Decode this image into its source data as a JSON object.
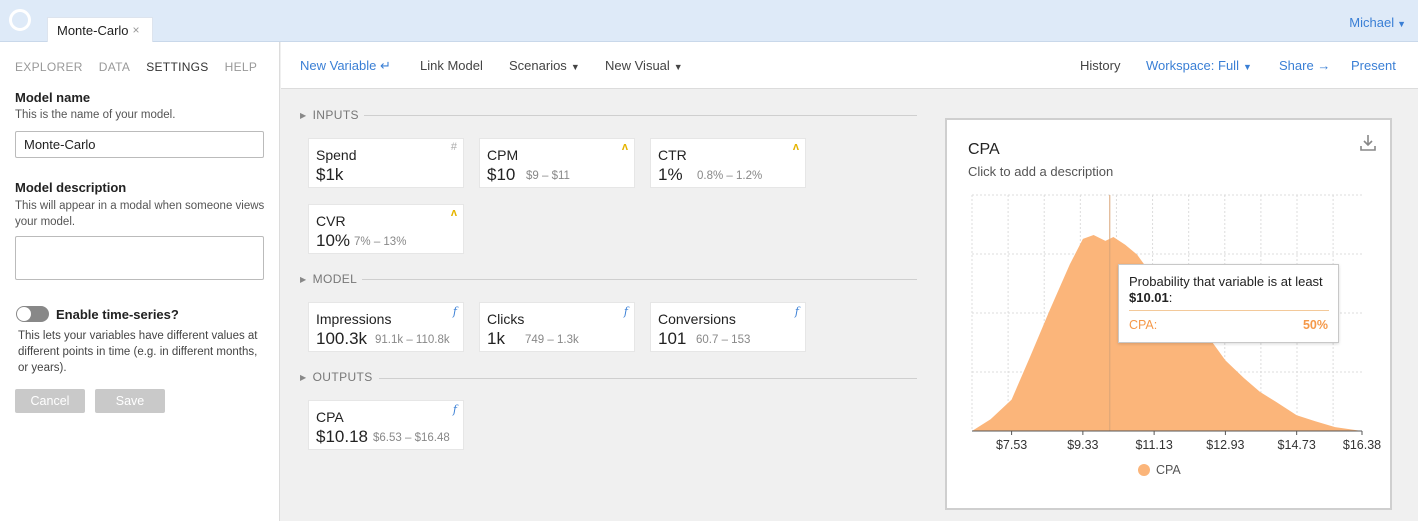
{
  "app": {
    "tab_label": "Monte-Carlo",
    "tab_close": "×",
    "user_name": "Michael"
  },
  "left_nav": [
    "EXPLORER",
    "DATA",
    "SETTINGS",
    "HELP"
  ],
  "left_nav_active": "SETTINGS",
  "settings": {
    "model_name_label": "Model name",
    "model_name_help": "This is the name of your model.",
    "model_name_value": "Monte-Carlo",
    "model_desc_label": "Model description",
    "model_desc_help": "This will appear in a modal when someone views your model.",
    "model_desc_value": "",
    "time_series_label": "Enable time-series?",
    "time_series_enabled": false,
    "time_series_help": "This lets your variables have different values at different points in time (e.g. in different months, or years).",
    "cancel_label": "Cancel",
    "save_label": "Save"
  },
  "toolbar": {
    "new_variable": "New Variable",
    "link_model": "Link Model",
    "scenarios": "Scenarios",
    "new_visual": "New Visual",
    "history": "History",
    "workspace": "Workspace: Full",
    "share": "Share",
    "present": "Present"
  },
  "sections": {
    "inputs": "INPUTS",
    "model": "MODEL",
    "outputs": "OUTPUTS"
  },
  "cards": {
    "spend": {
      "name": "Spend",
      "value": "$1k",
      "range": "",
      "icon": "hash-icon"
    },
    "cpm": {
      "name": "CPM",
      "value": "$10",
      "range": "$9 – $11",
      "icon": "distribution-icon"
    },
    "ctr": {
      "name": "CTR",
      "value": "1%",
      "range": "0.8% – 1.2%",
      "icon": "distribution-icon"
    },
    "cvr": {
      "name": "CVR",
      "value": "10%",
      "range": "7% – 13%",
      "icon": "distribution-icon"
    },
    "impressions": {
      "name": "Impressions",
      "value": "100.3k",
      "range": "91.1k – 110.8k",
      "icon": "function-icon"
    },
    "clicks": {
      "name": "Clicks",
      "value": "1k",
      "range": "749 – 1.3k",
      "icon": "function-icon"
    },
    "conversions": {
      "name": "Conversions",
      "value": "101",
      "range": "60.7 – 153",
      "icon": "function-icon"
    },
    "cpa": {
      "name": "CPA",
      "value": "$10.18",
      "range": "$6.53 – $16.48",
      "icon": "function-icon"
    }
  },
  "chart_panel": {
    "title": "CPA",
    "description": "Click to add a description",
    "tooltip_text_prefix": "Probability that variable is at least ",
    "tooltip_text_value": "$10.01",
    "tooltip_text_suffix": ":",
    "tooltip_series": "CPA:",
    "tooltip_value": "50%"
  },
  "chart_data": {
    "type": "area",
    "series": [
      {
        "name": "CPA",
        "color": "#fbb57a"
      }
    ],
    "x_ticks": [
      "$7.53",
      "$9.33",
      "$11.13",
      "$12.93",
      "$14.73",
      "$16.38"
    ],
    "x": [
      6.53,
      7.0,
      7.53,
      8.0,
      8.5,
      9.0,
      9.33,
      9.6,
      9.9,
      10.1,
      10.4,
      10.7,
      11.13,
      11.6,
      12.0,
      12.5,
      12.93,
      13.4,
      13.8,
      14.2,
      14.73,
      15.2,
      15.7,
      16.38
    ],
    "density": [
      0.0,
      0.06,
      0.16,
      0.38,
      0.62,
      0.85,
      0.98,
      1.0,
      0.97,
      0.99,
      0.95,
      0.9,
      0.78,
      0.68,
      0.55,
      0.48,
      0.36,
      0.27,
      0.2,
      0.15,
      0.08,
      0.05,
      0.02,
      0.0
    ],
    "xlim": [
      6.53,
      16.38
    ],
    "grid": true,
    "legend": "bottom",
    "marker_x": 10.01
  }
}
